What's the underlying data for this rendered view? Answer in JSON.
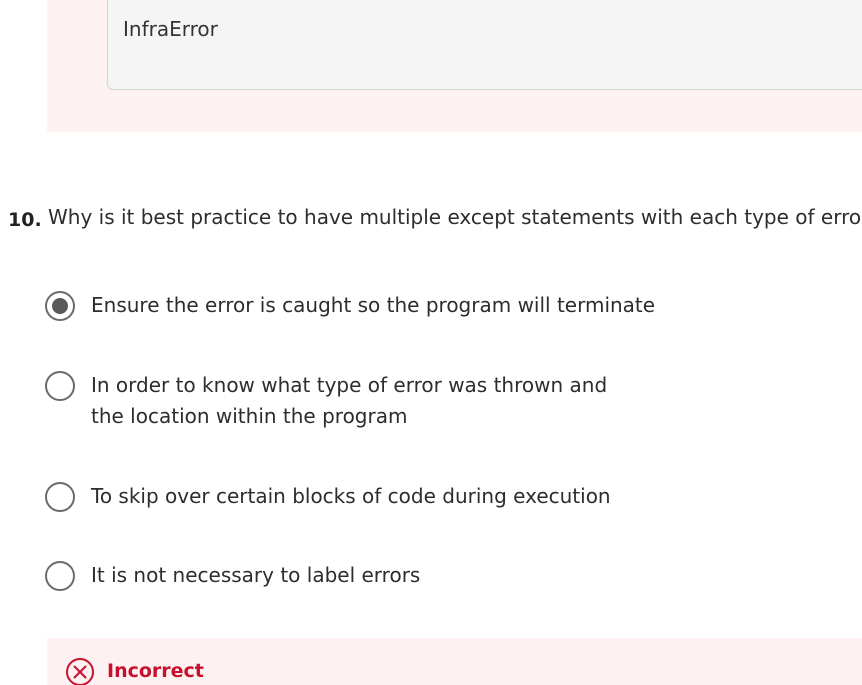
{
  "previous_question": {
    "answer_text": "InfraError"
  },
  "question": {
    "number": "10.",
    "text": "Why is it best practice to have multiple except statements with each type of error lal"
  },
  "options": [
    {
      "label": "Ensure the error is caught so the program will terminate",
      "selected": true
    },
    {
      "label": "In order to know what type of error was thrown and the location within the program",
      "selected": false
    },
    {
      "label": "To skip over certain blocks of code during execution",
      "selected": false
    },
    {
      "label": "It is not necessary to label errors",
      "selected": false
    }
  ],
  "feedback": {
    "status": "Incorrect",
    "icon": "x-circle-icon",
    "color": "#c8102e"
  }
}
